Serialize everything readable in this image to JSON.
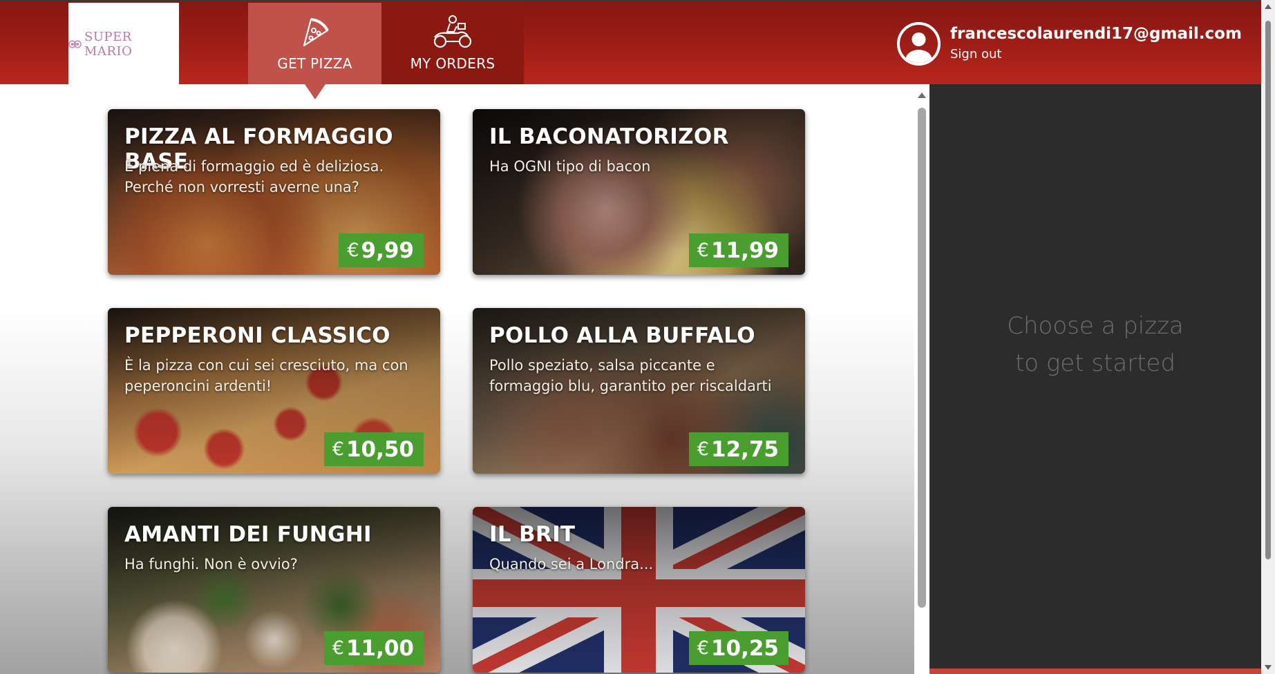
{
  "header": {
    "logo_text": "SUPER MARIO",
    "tabs": [
      {
        "label": "GET PIZZA",
        "icon": "pizza-slice-icon",
        "active": true
      },
      {
        "label": "MY ORDERS",
        "icon": "delivery-scooter-icon",
        "active": false
      }
    ],
    "user": {
      "email": "francescolaurendi17@gmail.com",
      "sign_out": "Sign out",
      "icon": "user-avatar-icon"
    }
  },
  "pizzas": [
    {
      "name": "PIZZA AL FORMAGGIO BASE",
      "description": "È piena di formaggio ed è deliziosa. Perché non vorresti averne una?",
      "currency": "€",
      "price": "9,99"
    },
    {
      "name": "IL BACONATORIZOR",
      "description": "Ha OGNI tipo di bacon",
      "currency": "€",
      "price": "11,99"
    },
    {
      "name": "PEPPERONI CLASSICO",
      "description": "È la pizza con cui sei cresciuto, ma con peperoncini ardenti!",
      "currency": "€",
      "price": "10,50"
    },
    {
      "name": "POLLO ALLA BUFFALO",
      "description": "Pollo speziato, salsa piccante e formaggio blu, garantito per riscaldarti",
      "currency": "€",
      "price": "12,75"
    },
    {
      "name": "AMANTI DEI FUNGHI",
      "description": "Ha funghi. Non è ovvio?",
      "currency": "€",
      "price": "11,00"
    },
    {
      "name": "IL BRIT",
      "description": "Quando sei a Londra...",
      "currency": "€",
      "price": "10,25"
    }
  ],
  "side_panel": {
    "message_line1": "Choose a pizza",
    "message_line2": "to get started"
  },
  "colors": {
    "header_red": "#9f1e17",
    "active_tab": "#c0514b",
    "price_green": "#4a9e2f",
    "side_panel": "#2c2c2c"
  }
}
